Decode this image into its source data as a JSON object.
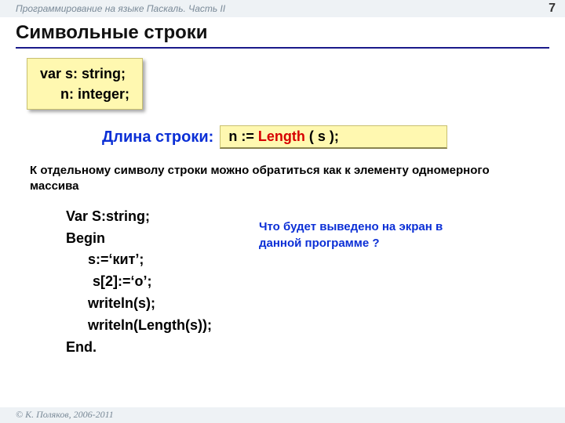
{
  "header": {
    "course": "Программирование на языке Паскаль. Часть II",
    "page": "7"
  },
  "title": "Символьные строки",
  "decl_box": {
    "line1": "var s: string;",
    "line2": "n: integer;"
  },
  "length_row": {
    "label": "Длина строки:",
    "code_prefix": "n := ",
    "code_keyword": "Length",
    "code_suffix": " ( s );"
  },
  "note": "К отдельному символу строки можно обратиться как к элементу одномерного массива",
  "program": {
    "l1": "Var S:string;",
    "l2": "Begin",
    "l3": "s:=‘кит’;",
    "l4": "s[2]:=‘о’;",
    "l5": "writeln(s);",
    "l6": "writeln(Length(s));",
    "l7": "End."
  },
  "question": "Что будет выведено на экран в данной программе ?",
  "footer": {
    "copyright": "© К. Поляков, 2006-2011"
  }
}
